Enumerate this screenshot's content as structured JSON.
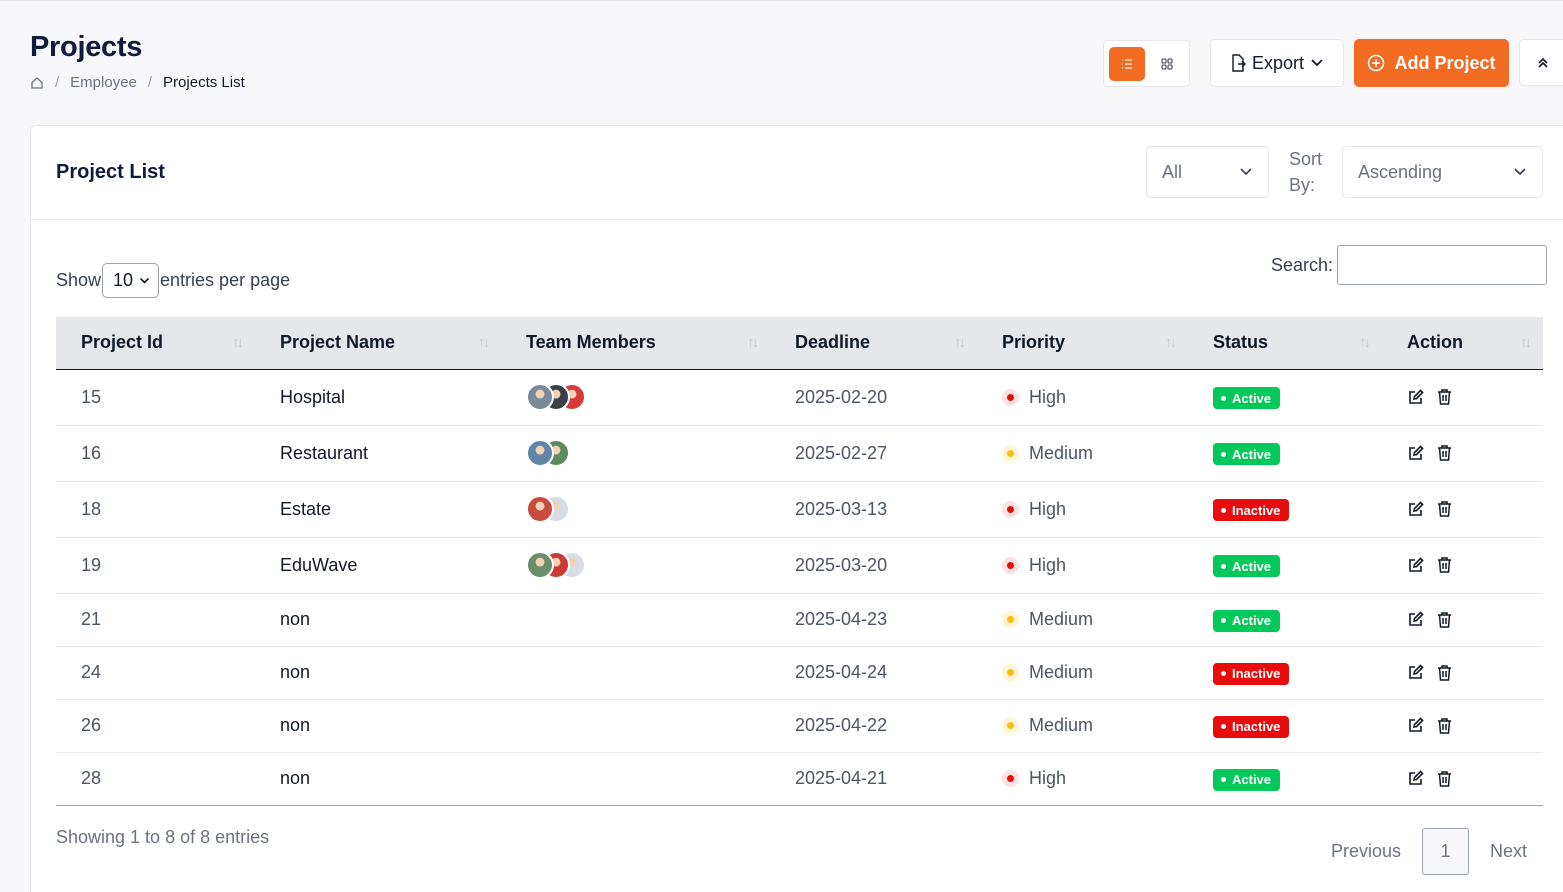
{
  "header": {
    "title": "Projects",
    "breadcrumb": [
      "Employee",
      "Projects List"
    ]
  },
  "toolbar": {
    "export_label": "Export",
    "add_label": "Add Project"
  },
  "card": {
    "title": "Project List",
    "filter_value": "All",
    "sort_label": "Sort By:",
    "sort_value": "Ascending"
  },
  "controls": {
    "show_label": "Show",
    "page_size": "10",
    "entries_label": "entries per page",
    "search_label": "Search:",
    "search_value": ""
  },
  "table": {
    "columns": [
      "Project Id",
      "Project Name",
      "Team Members",
      "Deadline",
      "Priority",
      "Status",
      "Action"
    ],
    "rows": [
      {
        "id": "15",
        "name": "Hospital",
        "members": 3,
        "deadline": "2025-02-20",
        "priority": "High",
        "status": "Active"
      },
      {
        "id": "16",
        "name": "Restaurant",
        "members": 2,
        "deadline": "2025-02-27",
        "priority": "Medium",
        "status": "Active"
      },
      {
        "id": "18",
        "name": "Estate",
        "members": 2,
        "deadline": "2025-03-13",
        "priority": "High",
        "status": "Inactive"
      },
      {
        "id": "19",
        "name": "EduWave",
        "members": 3,
        "deadline": "2025-03-20",
        "priority": "High",
        "status": "Active"
      },
      {
        "id": "21",
        "name": "non",
        "members": 0,
        "deadline": "2025-04-23",
        "priority": "Medium",
        "status": "Active"
      },
      {
        "id": "24",
        "name": "non",
        "members": 0,
        "deadline": "2025-04-24",
        "priority": "Medium",
        "status": "Inactive"
      },
      {
        "id": "26",
        "name": "non",
        "members": 0,
        "deadline": "2025-04-22",
        "priority": "Medium",
        "status": "Inactive"
      },
      {
        "id": "28",
        "name": "non",
        "members": 0,
        "deadline": "2025-04-21",
        "priority": "High",
        "status": "Active"
      }
    ]
  },
  "footer": {
    "info": "Showing 1 to 8 of 8 entries",
    "previous": "Previous",
    "current_page": "1",
    "next": "Next"
  },
  "colors": {
    "accent": "#f26b22",
    "active": "#03c95a",
    "inactive": "#e70d0d",
    "high": "#e70d0d",
    "medium": "#fdbd0f"
  },
  "icons": [
    "home-icon",
    "list-view-icon",
    "grid-view-icon",
    "file-export-icon",
    "chevron-down-icon",
    "plus-circle-icon",
    "chevrons-up-icon",
    "sort-icon",
    "edit-icon",
    "trash-icon"
  ]
}
